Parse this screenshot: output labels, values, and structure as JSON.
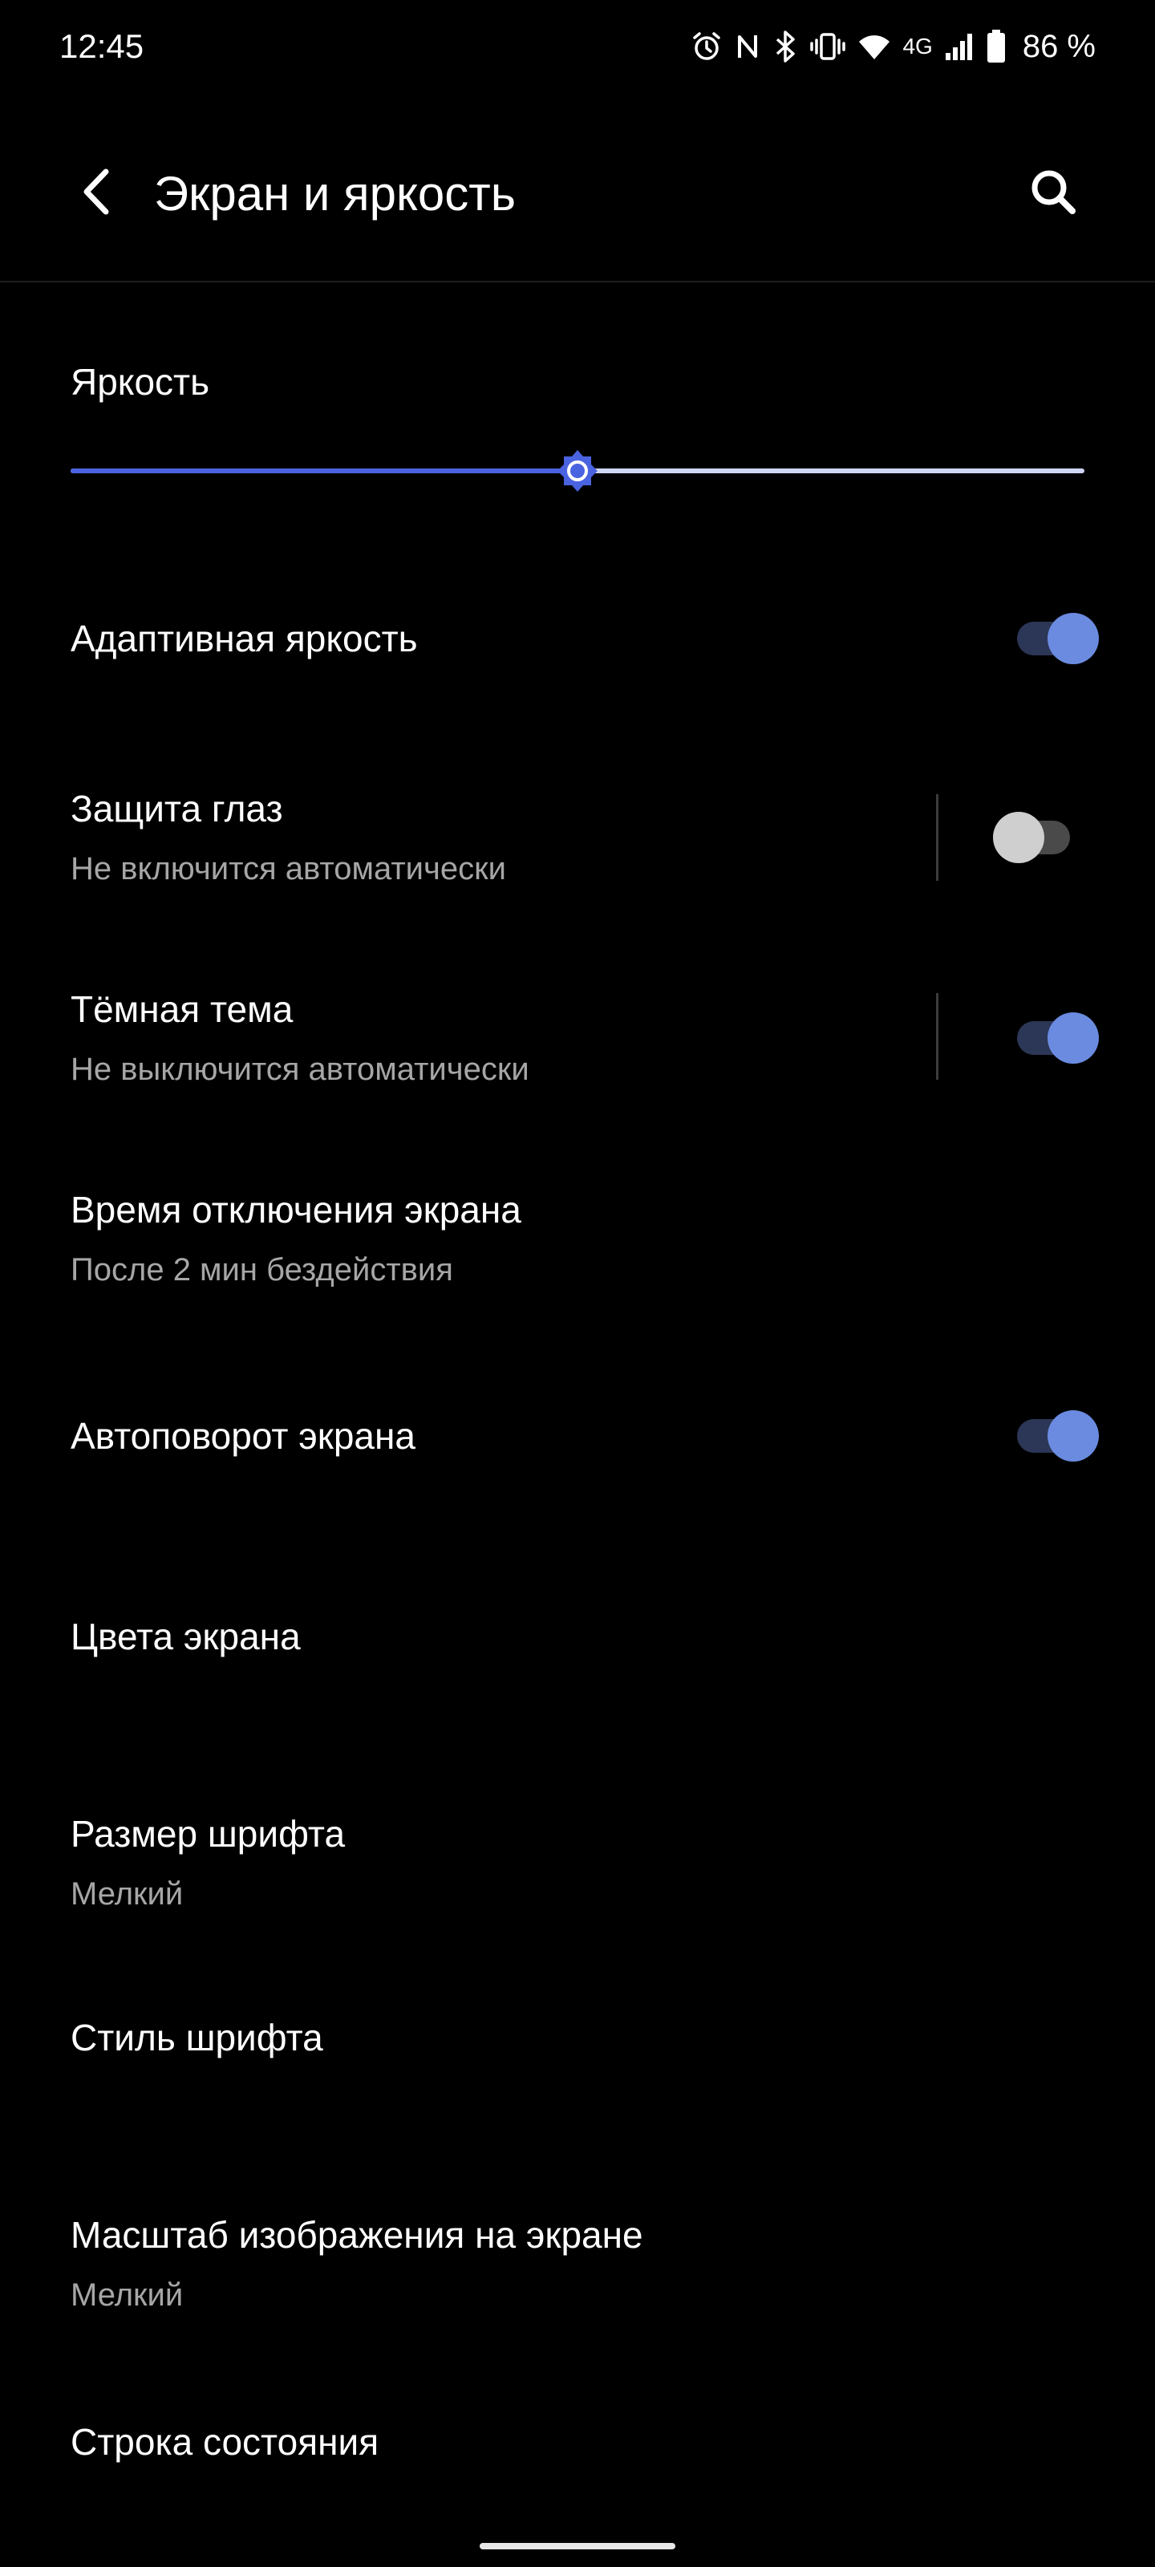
{
  "status_bar": {
    "time": "12:45",
    "icons": [
      "alarm-icon",
      "nfc-icon",
      "bluetooth-icon",
      "vibrate-icon",
      "wifi-icon",
      "signal-icon",
      "battery-icon"
    ],
    "network_label": "4G",
    "battery_text": "86 %",
    "battery_level": 0.86
  },
  "app_bar": {
    "title": "Экран и яркость",
    "back_icon": "back-arrow-icon",
    "search_icon": "search-icon"
  },
  "brightness": {
    "label": "Яркость",
    "level": 0.5,
    "fill_color": "#4a63e0",
    "track_color": "#cfd6f5",
    "thumb_icon": "brightness-sun-icon"
  },
  "settings": {
    "adaptive_brightness": {
      "title": "Адаптивная яркость",
      "enabled": true
    },
    "eye_protection": {
      "title": "Защита глаз",
      "subtitle": "Не включится автоматически",
      "enabled": false
    },
    "dark_theme": {
      "title": "Тёмная тема",
      "subtitle": "Не выключится автоматически",
      "enabled": true
    },
    "screen_timeout": {
      "title": "Время отключения экрана",
      "subtitle": "После 2 мин бездействия"
    },
    "auto_rotate": {
      "title": "Автоповорот экрана",
      "enabled": true
    },
    "screen_colors": {
      "title": "Цвета экрана"
    },
    "font_size": {
      "title": "Размер шрифта",
      "subtitle": "Мелкий"
    },
    "font_style": {
      "title": "Стиль шрифта"
    },
    "display_scale": {
      "title": "Масштаб изображения на экране",
      "subtitle": "Мелкий"
    },
    "status_bar_setting": {
      "title": "Строка состояния"
    }
  },
  "colors": {
    "background": "#000000",
    "accent": "#6a8be0",
    "secondary_text": "#a6a6a6"
  }
}
